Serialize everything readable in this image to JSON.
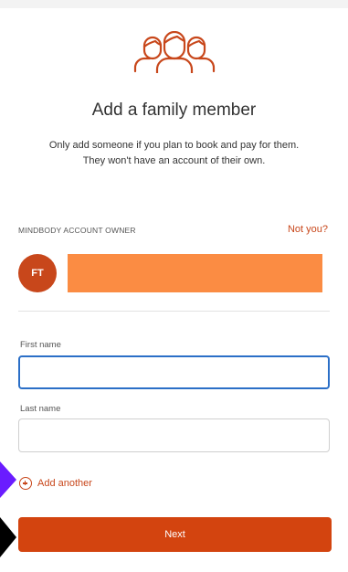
{
  "header": {
    "icon": "family-people-icon",
    "title": "Add a family member",
    "subtitle_line1": "Only add someone if you plan to book and pay for them.",
    "subtitle_line2": "They won't have an account of their own."
  },
  "owner": {
    "section_label": "MINDBODY ACCOUNT OWNER",
    "not_you_link": "Not you?",
    "avatar_initials": "FT",
    "name_redacted_color": "#fb8c43"
  },
  "form": {
    "first_name_label": "First name",
    "first_name_value": "",
    "last_name_label": "Last name",
    "last_name_value": ""
  },
  "actions": {
    "add_another_label": "Add another",
    "add_another_icon": "plus-circle-icon",
    "next_label": "Next"
  },
  "colors": {
    "accent": "#c8471b",
    "button": "#d3440f",
    "focus_border": "#2b6fc7",
    "annotation_purple": "#6a1cff",
    "annotation_black": "#000000"
  }
}
